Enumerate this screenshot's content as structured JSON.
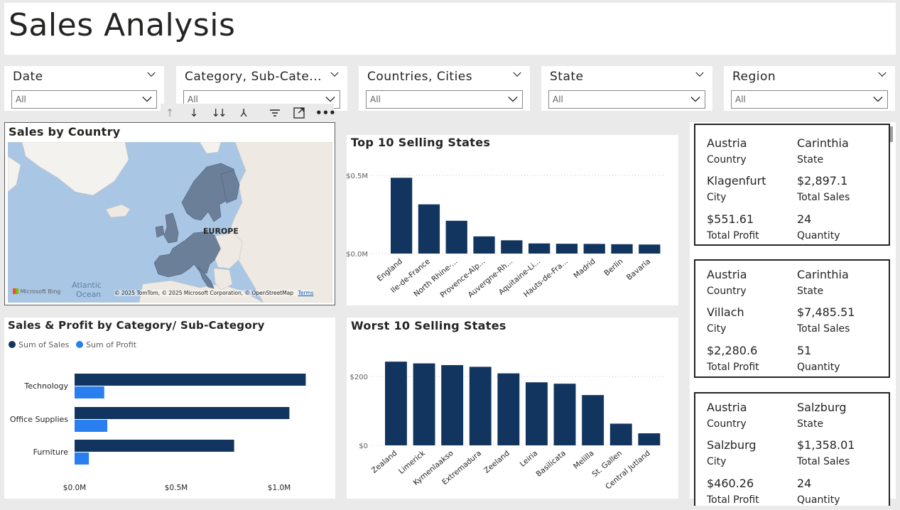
{
  "page": {
    "title": "Sales Analysis"
  },
  "slicers": [
    {
      "title": "Date",
      "value": "All"
    },
    {
      "title": "Category, Sub-Cate...",
      "value": "All"
    },
    {
      "title": "Countries, Cities",
      "value": "All"
    },
    {
      "title": "State",
      "value": "All"
    },
    {
      "title": "Region",
      "value": "All"
    }
  ],
  "toolbar_icons": [
    "drill-up-icon",
    "drill-down-icon",
    "expand-all-down-icon",
    "expand-hierarchy-icon",
    "filter-icon",
    "focus-mode-icon",
    "more-options-icon"
  ],
  "map": {
    "title": "Sales by Country",
    "region_label": "EUROPE",
    "ocean_label_1": "Atlantic",
    "ocean_label_2": "Ocean",
    "bing_logo": "Microsoft Bing",
    "attribution": "© 2025 TomTom, © 2025 Microsoft Corporation, © OpenStreetMap",
    "terms": "Terms"
  },
  "chart_data": [
    {
      "type": "bar",
      "title": "Top 10 Selling States",
      "categories": [
        "England",
        "Ile-de-France",
        "North Rhine-...",
        "Provence-Alp...",
        "Auvergne-Rh...",
        "Aquitaine-Li...",
        "Hauts-de-Fra...",
        "Madrid",
        "Berlin",
        "Bavaria"
      ],
      "tick_labels": [
        "$0.0M",
        "$0.5M"
      ],
      "values": [
        0.485,
        0.315,
        0.21,
        0.11,
        0.085,
        0.065,
        0.063,
        0.062,
        0.06,
        0.058
      ],
      "ylim": [
        0,
        0.5
      ],
      "grid": true
    },
    {
      "type": "bar",
      "title": "Worst 10 Selling States",
      "categories": [
        "Zealand",
        "Limerick",
        "Kymenlaakso",
        "Extremadura",
        "Zeeland",
        "Leiria",
        "Basilicata",
        "Melilla",
        "St. Gallen",
        "Central Jutland"
      ],
      "tick_labels": [
        "$0",
        "$200"
      ],
      "values": [
        243,
        238,
        233,
        228,
        209,
        183,
        179,
        146,
        63,
        35
      ],
      "ylim": [
        0,
        200
      ],
      "grid": true
    },
    {
      "type": "bar",
      "orientation": "horizontal",
      "title": "Sales & Profit by Category/ Sub-Category",
      "categories": [
        "Technology",
        "Office Supplies",
        "Furniture"
      ],
      "tick_labels": [
        "$0.0M",
        "$0.5M",
        "$1.0M"
      ],
      "series": [
        {
          "name": "Sum of Sales",
          "values": [
            1.13,
            1.05,
            0.78
          ],
          "color": "#12355f"
        },
        {
          "name": "Sum of Profit",
          "values": [
            0.145,
            0.16,
            0.07
          ],
          "color": "#2a7ff0"
        }
      ],
      "xlim": [
        0,
        1.0
      ],
      "legend": "top-left"
    }
  ],
  "cards": [
    {
      "country": "Austria",
      "country_lbl": "Country",
      "state": "Carinthia",
      "state_lbl": "State",
      "city": "Klagenfurt",
      "city_lbl": "City",
      "sales": "$2,897.1",
      "sales_lbl": "Total Sales",
      "profit": "$551.61",
      "profit_lbl": "Total Profit",
      "qty": "24",
      "qty_lbl": "Quantity"
    },
    {
      "country": "Austria",
      "country_lbl": "Country",
      "state": "Carinthia",
      "state_lbl": "State",
      "city": "Villach",
      "city_lbl": "City",
      "sales": "$7,485.51",
      "sales_lbl": "Total Sales",
      "profit": "$2,280.6",
      "profit_lbl": "Total Profit",
      "qty": "51",
      "qty_lbl": "Quantity"
    },
    {
      "country": "Austria",
      "country_lbl": "Country",
      "state": "Salzburg",
      "state_lbl": "State",
      "city": "Salzburg",
      "city_lbl": "City",
      "sales": "$1,358.01",
      "sales_lbl": "Total Sales",
      "profit": "$460.26",
      "profit_lbl": "Total Profit",
      "qty": "24",
      "qty_lbl": "Quantity"
    }
  ],
  "colors": {
    "bar": "#12355f",
    "profit": "#2a7ff0",
    "map_land": "#eeeae3",
    "map_water": "#a9c7e4",
    "map_highlight": "#6b7f99"
  }
}
